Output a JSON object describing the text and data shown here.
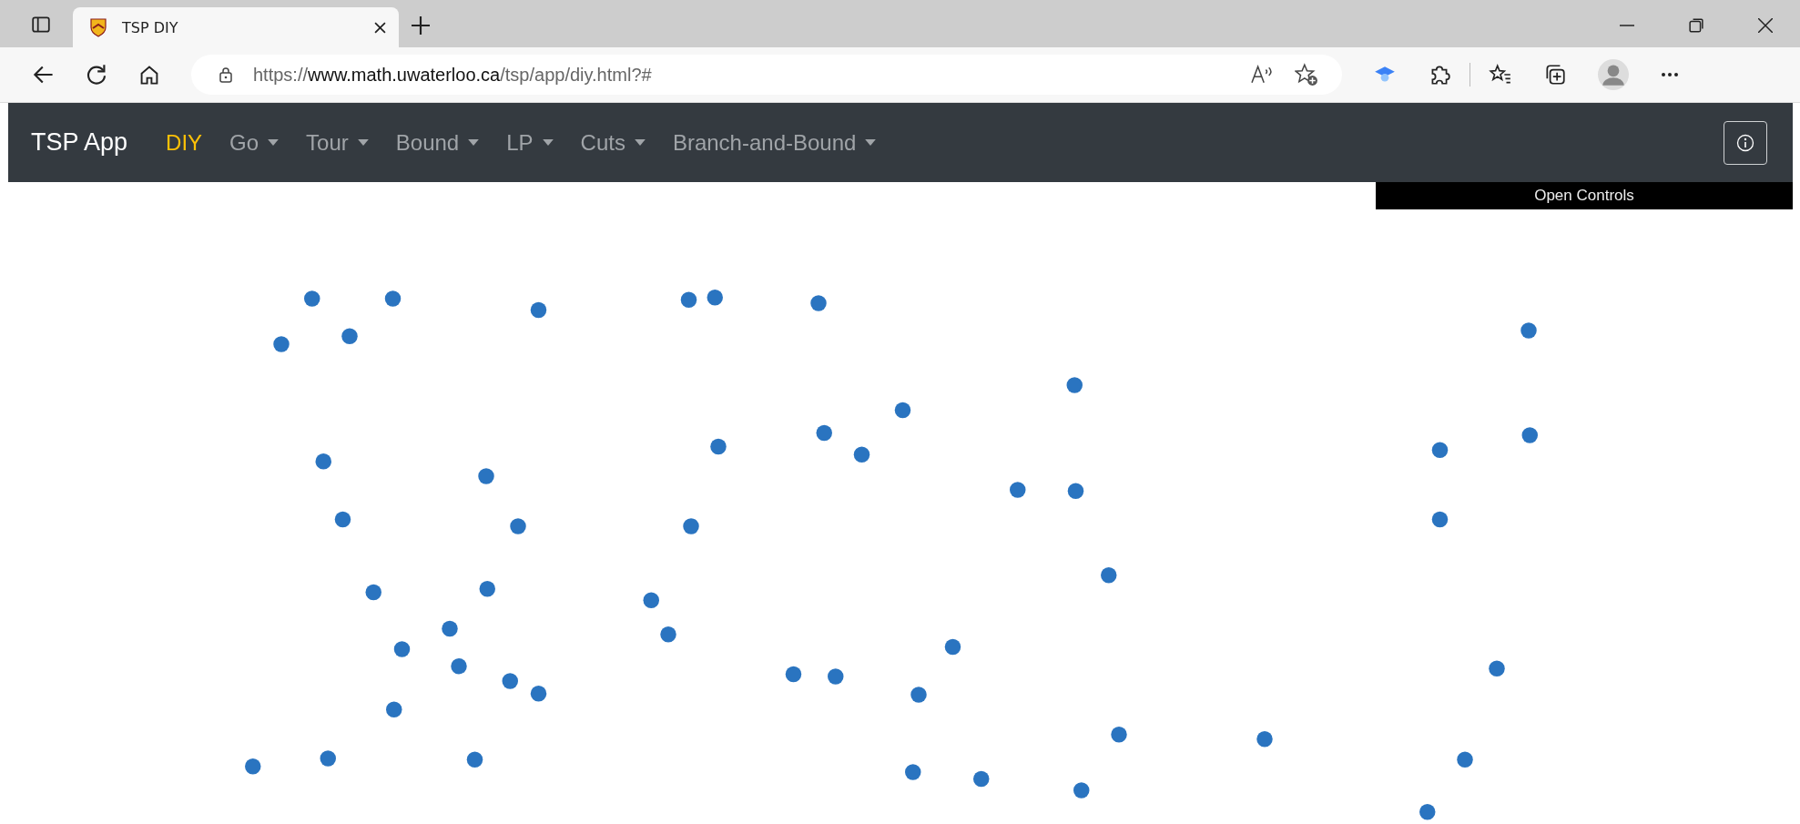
{
  "browser": {
    "tabs": [
      {
        "title": "TSP DIY",
        "selected": true
      }
    ],
    "address": {
      "scheme": "https://",
      "host": "www.math.uwaterloo.ca",
      "path": "/tsp/app/diy.html?#"
    }
  },
  "navbar": {
    "brand": "TSP App",
    "items": [
      {
        "label": "DIY",
        "selected": true,
        "dropdown": false
      },
      {
        "label": "Go",
        "selected": false,
        "dropdown": true
      },
      {
        "label": "Tour",
        "selected": false,
        "dropdown": true
      },
      {
        "label": "Bound",
        "selected": false,
        "dropdown": true
      },
      {
        "label": "LP",
        "selected": false,
        "dropdown": true
      },
      {
        "label": "Cuts",
        "selected": false,
        "dropdown": true
      },
      {
        "label": "Branch-and-Bound",
        "selected": false,
        "dropdown": true
      }
    ]
  },
  "controls_bar": {
    "label": "Open Controls"
  }
}
